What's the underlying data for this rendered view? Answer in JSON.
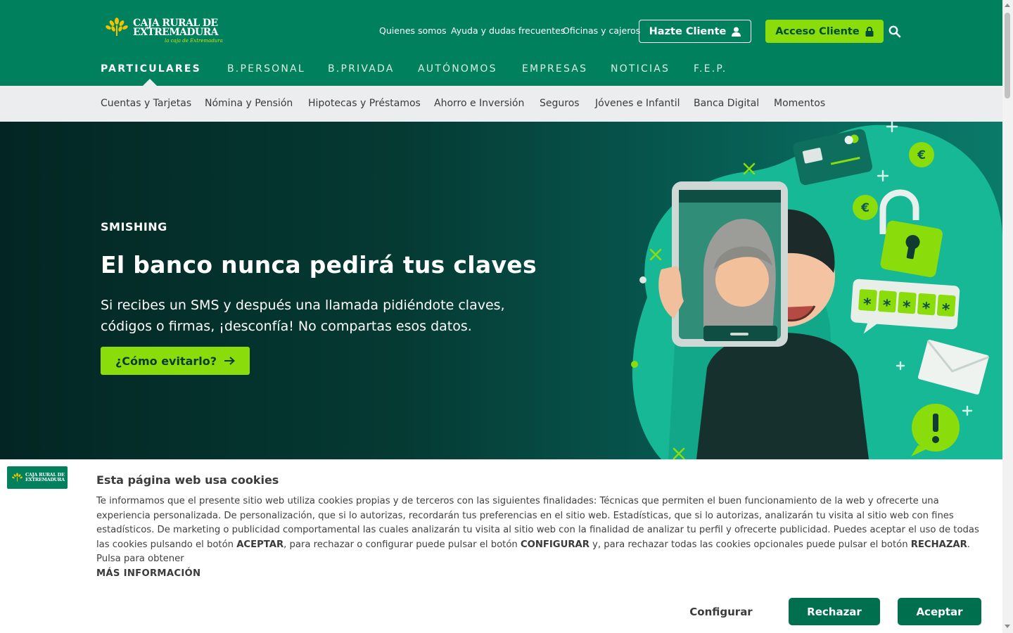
{
  "brand": {
    "name_line1": "CAJA RURAL DE",
    "name_line2": "EXTREMADURA",
    "tagline": "la caja de Extremadura"
  },
  "header": {
    "links": [
      "Quienes somos",
      "Ayuda y dudas frecuentes",
      "Oficinas y cajeros"
    ],
    "hazte_cliente": "Hazte Cliente",
    "acceso_cliente": "Acceso Cliente",
    "colors": {
      "primary": "#00805c",
      "accent": "#8bdc0b"
    }
  },
  "main_nav": [
    "PARTICULARES",
    "B.PERSONAL",
    "B.PRIVADA",
    "AUTÓNOMOS",
    "EMPRESAS",
    "NOTICIAS",
    "F.E.P."
  ],
  "sub_nav": [
    "Cuentas y Tarjetas",
    "Nómina y Pensión",
    "Hipotecas y Préstamos",
    "Ahorro e Inversión",
    "Seguros",
    "Jóvenes e Infantil",
    "Banca Digital",
    "Momentos"
  ],
  "hero": {
    "eyebrow": "SMISHING",
    "title": "El banco nunca pedirá tus claves",
    "text": "Si recibes un SMS y después una llamada pidiéndote claves, códigos o firmas, ¡desconfía! No compartas esos datos.",
    "cta": "¿Cómo evitarlo?",
    "art_password": [
      "*",
      "*",
      "*",
      "*",
      "*"
    ]
  },
  "cookies": {
    "logo_line1": "CAJA RURAL DE",
    "logo_line2": "EXTREMADURA",
    "title": "Esta página web usa cookies",
    "text_part1": "Te informamos que el presente sitio web utiliza cookies propias y de terceros con las siguientes finalidades: Técnicas que permiten el buen funcionamiento de la web y ofrecerte una experiencia personalizada. De personalización, que si lo autorizas, recordarán tus preferencias en el sitio web. Estadísticas, que si lo autorizas, analizarán tu visita al sitio web con fines estadísticos. De marketing o publicidad comportamental las cuales analizarán tu visita al sitio web con la finalidad de analizar tu perfil y ofrecerte publicidad. Puedes aceptar el uso de todas las cookies pulsando el botón ",
    "kw_aceptar": "ACEPTAR",
    "text_part2": ", para rechazar o configurar puede pulsar el botón ",
    "kw_configurar": "CONFIGURAR",
    "text_part3": " y, para rechazar todas las cookies opcionales puede pulsar el botón ",
    "kw_rechazar": "RECHAZAR",
    "text_part4": ". Pulsa para obtener",
    "mas_info": "MÁS INFORMACIÓN",
    "btn_configurar": "Configurar",
    "btn_rechazar": "Rechazar",
    "btn_aceptar": "Aceptar"
  }
}
